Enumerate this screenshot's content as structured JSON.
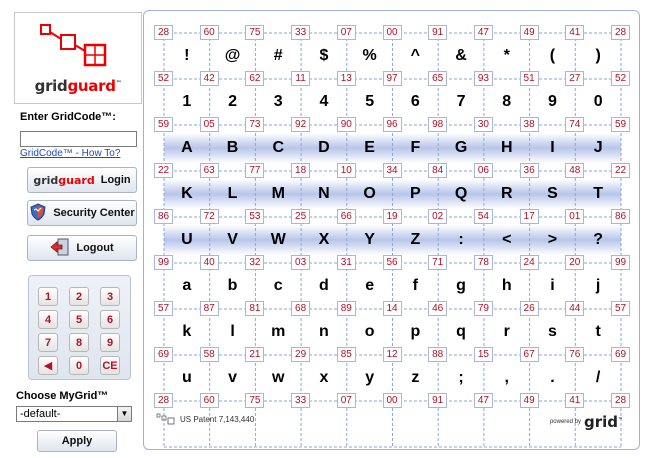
{
  "logo": {
    "text_a": "grid",
    "text_b": "guard",
    "mark": "™"
  },
  "gridcode": {
    "label": "Enter GridCode™:",
    "value": "",
    "howto": "GridCode™ - How To?"
  },
  "buttons": {
    "login_brand_a": "grid",
    "login_brand_b": "guard",
    "login": "Login",
    "security": "Security Center",
    "logout": "Logout",
    "apply": "Apply"
  },
  "keypad": [
    "1",
    "2",
    "3",
    "4",
    "5",
    "6",
    "7",
    "8",
    "9",
    "◀",
    "0",
    "CE"
  ],
  "mygrid": {
    "label": "Choose MyGrid™",
    "selected": "-default-"
  },
  "grid": {
    "top_numbers": [
      "28",
      "60",
      "75",
      "33",
      "07",
      "00",
      "91",
      "47",
      "49",
      "41",
      "28"
    ],
    "rows": [
      {
        "left": "28",
        "right": "28",
        "chars": [
          "!",
          "@",
          "#",
          "$",
          "%",
          "^",
          "&",
          "*",
          "(",
          ")"
        ]
      },
      {
        "left": "52",
        "right": "52",
        "mids": [
          "42",
          "62",
          "11",
          "13",
          "97",
          "65",
          "93",
          "51",
          "27"
        ],
        "chars": [
          "1",
          "2",
          "3",
          "4",
          "5",
          "6",
          "7",
          "8",
          "9",
          "0"
        ]
      },
      {
        "left": "59",
        "right": "59",
        "mids": [
          "05",
          "73",
          "92",
          "90",
          "96",
          "98",
          "30",
          "38",
          "74"
        ],
        "chars": [
          "A",
          "B",
          "C",
          "D",
          "E",
          "F",
          "G",
          "H",
          "I",
          "J"
        ]
      },
      {
        "left": "22",
        "right": "22",
        "mids": [
          "63",
          "77",
          "18",
          "10",
          "34",
          "84",
          "06",
          "36",
          "48"
        ],
        "chars": [
          "K",
          "L",
          "M",
          "N",
          "O",
          "P",
          "Q",
          "R",
          "S",
          "T"
        ]
      },
      {
        "left": "86",
        "right": "86",
        "mids": [
          "72",
          "53",
          "25",
          "66",
          "19",
          "02",
          "54",
          "17",
          "01"
        ],
        "chars": [
          "U",
          "V",
          "W",
          "X",
          "Y",
          "Z",
          ":",
          "<",
          ">",
          "?"
        ]
      },
      {
        "left": "99",
        "right": "99",
        "mids": [
          "40",
          "32",
          "03",
          "31",
          "56",
          "71",
          "78",
          "24",
          "20"
        ],
        "chars": [
          "a",
          "b",
          "c",
          "d",
          "e",
          "f",
          "g",
          "h",
          "i",
          "j"
        ]
      },
      {
        "left": "57",
        "right": "57",
        "mids": [
          "87",
          "81",
          "68",
          "89",
          "14",
          "46",
          "79",
          "26",
          "44"
        ],
        "chars": [
          "k",
          "l",
          "m",
          "n",
          "o",
          "p",
          "q",
          "r",
          "s",
          "t"
        ]
      },
      {
        "left": "69",
        "right": "69",
        "mids": [
          "58",
          "21",
          "29",
          "85",
          "12",
          "88",
          "15",
          "67",
          "76"
        ],
        "chars": [
          "u",
          "v",
          "w",
          "x",
          "y",
          "z",
          ";",
          ",",
          ".",
          "/"
        ]
      }
    ],
    "bottom_numbers": [
      "28",
      "60",
      "75",
      "33",
      "07",
      "00",
      "91",
      "47",
      "49",
      "41",
      "28"
    ]
  },
  "footer": {
    "patent": "US Patent 7,143,440",
    "powered": "powered by",
    "brand": "grid",
    "mark": "™"
  },
  "colors": {
    "number": "#b0102a",
    "accent": "#e00000",
    "band": "#b8c5ea",
    "panel_border": "#9cb3d9"
  }
}
